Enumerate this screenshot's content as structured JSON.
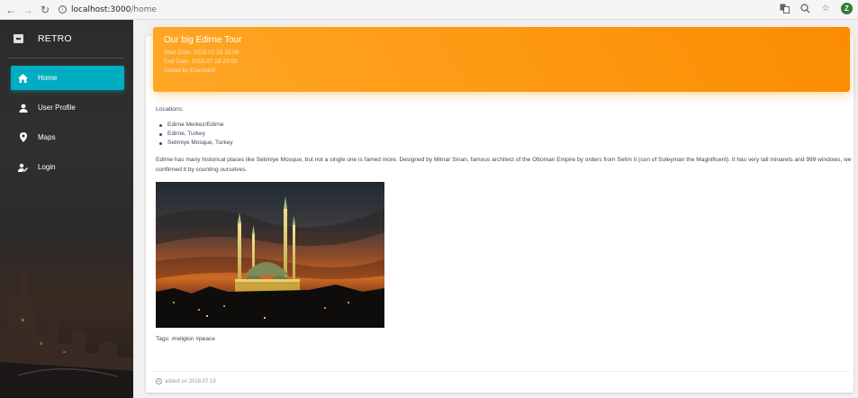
{
  "browser": {
    "url_host": "localhost:3000",
    "url_path": "/home",
    "avatar_letter": "Z"
  },
  "sidebar": {
    "brand": "RETRO",
    "items": [
      {
        "label": "Home",
        "icon": "home-icon",
        "active": true
      },
      {
        "label": "User Profile",
        "icon": "person-icon",
        "active": false
      },
      {
        "label": "Maps",
        "icon": "location-pin-icon",
        "active": false
      },
      {
        "label": "Login",
        "icon": "user-key-icon",
        "active": false
      }
    ]
  },
  "tour": {
    "title": "Our big Edirne Tour",
    "start_date": "Start Date: 2018.07.18 18:00",
    "end_date": "End Date: 2018.07.18 20:00",
    "added_by": "Added by EceAta00",
    "locations_label": "Locations:",
    "locations": [
      "Edirne Merkez/Edirne",
      "Edirne, Turkey",
      "Selimiye Mosque, Turkey"
    ],
    "description": "Edirne has many historical places like Selimiye Mosque, but not a single one is famed more. Designed by Mimar Sinan, famous architect of the Ottoman Empire by orders from Selim II (son of Suleyman the Magnificent). It has very tall minarets and 999 windows, we confirmed it by counting ourselves.",
    "tags": "Tags: #religion #peace",
    "added_on": "added on 2018.07.19"
  },
  "colors": {
    "accent_cyan": "#00acc1",
    "header_orange": "#fb8c00"
  }
}
